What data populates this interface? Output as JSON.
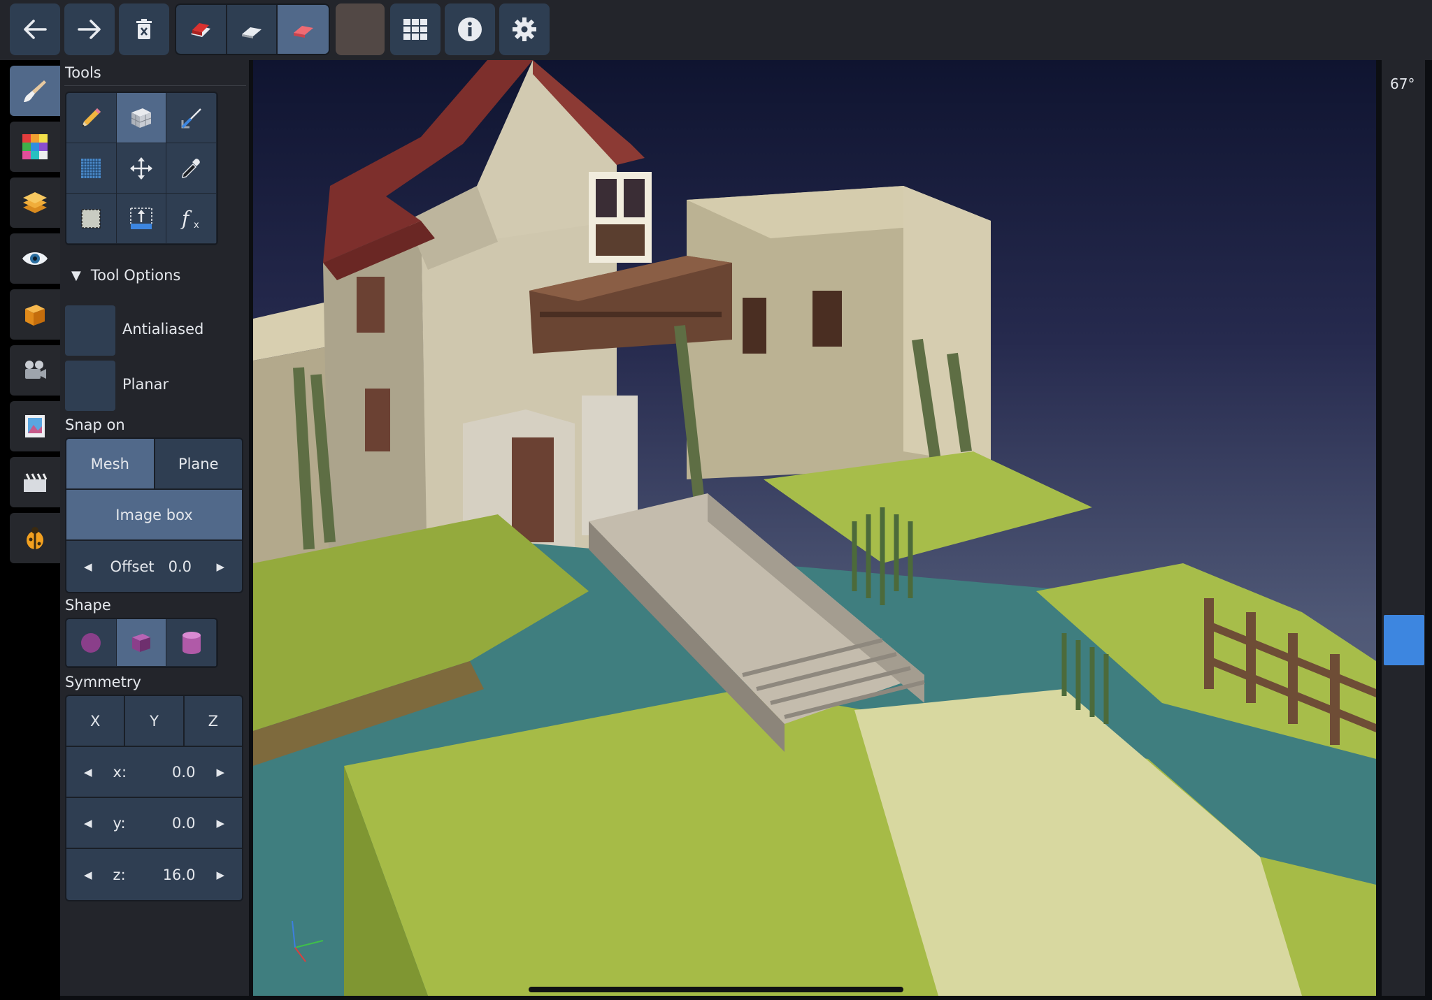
{
  "toolbar": {
    "buttons": [
      "undo-icon",
      "redo-icon",
      "delete-icon",
      "paint-icon",
      "erase-icon",
      "attach-icon",
      "color-swatch",
      "grid-icon",
      "info-icon",
      "gear-icon"
    ],
    "current_color": "#524845"
  },
  "sidebar": {
    "items": [
      "brush-icon",
      "palette-icon",
      "layers-icon",
      "eye-icon",
      "cube-icon",
      "camera-icon",
      "image-icon",
      "clapper-icon",
      "bug-icon"
    ],
    "active_index": 0
  },
  "tools": {
    "title": "Tools",
    "items": [
      "pencil",
      "box",
      "laser",
      "plane",
      "move",
      "picker",
      "selection",
      "extrude",
      "procedural"
    ],
    "active_index": 1
  },
  "tool_options": {
    "title": "Tool Options",
    "expander": "▼",
    "antialiased": "Antialiased",
    "planar": "Planar"
  },
  "snap": {
    "title": "Snap on",
    "mesh": "Mesh",
    "plane": "Plane",
    "image_box": "Image box",
    "offset_label": "Offset",
    "offset_value": "0.0"
  },
  "shape": {
    "title": "Shape",
    "items": [
      "sphere",
      "cube",
      "cylinder"
    ],
    "active_index": 1
  },
  "symmetry": {
    "title": "Symmetry",
    "x": "X",
    "y": "Y",
    "z": "Z",
    "x_label": "x:",
    "x_value": "0.0",
    "y_label": "y:",
    "y_value": "0.0",
    "z_label": "z:",
    "z_value": "16.0"
  },
  "arrows": {
    "left": "◀",
    "right": "▶"
  },
  "viewport": {
    "fov": "67°"
  },
  "colors": {
    "accent": "#51698a",
    "button": "#2f3e52",
    "panel": "#23252b",
    "slider": "#3d86e0"
  }
}
